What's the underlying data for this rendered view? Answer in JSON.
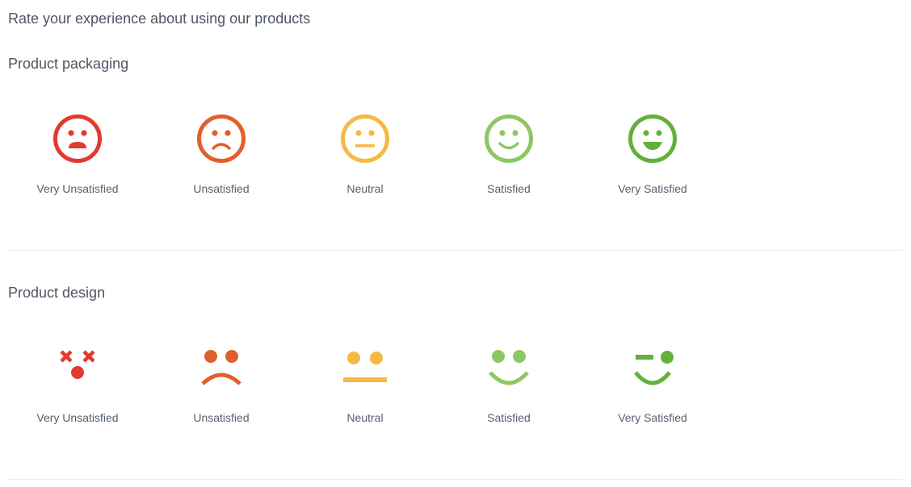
{
  "page": {
    "title": "Rate your experience about using our products"
  },
  "colors": {
    "very_unsatisfied": "#e23a2e",
    "unsatisfied": "#e05f2c",
    "neutral": "#f5b944",
    "satisfied": "#8cc862",
    "very_satisfied": "#63b03a"
  },
  "sections": [
    {
      "title": "Product packaging",
      "style": "outlined-faces",
      "options": [
        {
          "label": "Very Unsatisfied",
          "icon": "very-unsatisfied-face-icon"
        },
        {
          "label": "Unsatisfied",
          "icon": "unsatisfied-face-icon"
        },
        {
          "label": "Neutral",
          "icon": "neutral-face-icon"
        },
        {
          "label": "Satisfied",
          "icon": "satisfied-face-icon"
        },
        {
          "label": "Very Satisfied",
          "icon": "very-satisfied-face-icon"
        }
      ]
    },
    {
      "title": "Product design",
      "style": "minimal-faces",
      "options": [
        {
          "label": "Very Unsatisfied",
          "icon": "dizzy-face-icon"
        },
        {
          "label": "Unsatisfied",
          "icon": "frown-face-icon"
        },
        {
          "label": "Neutral",
          "icon": "neutral-face-icon"
        },
        {
          "label": "Satisfied",
          "icon": "smile-face-icon"
        },
        {
          "label": "Very Satisfied",
          "icon": "wink-face-icon"
        }
      ]
    }
  ]
}
